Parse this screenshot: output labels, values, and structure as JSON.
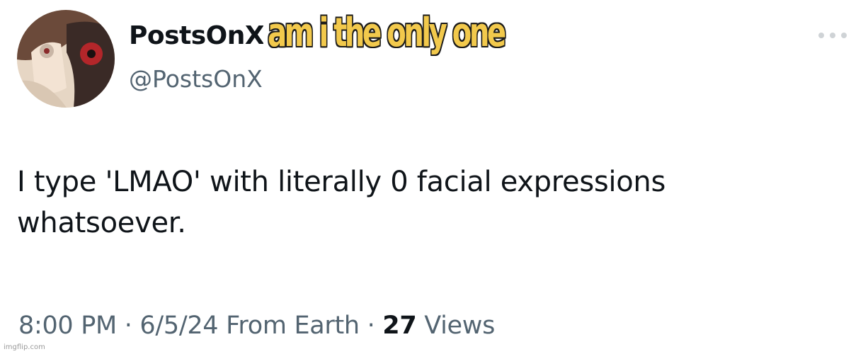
{
  "tweet": {
    "display_name": "PostsOnX",
    "handle": "@PostsOnX",
    "text": "I type 'LMAO' with literally 0 facial expressions whatsoever.",
    "time": "8:00 PM",
    "date": "6/5/24",
    "source": "From Earth",
    "separator": "·",
    "views_count": "27",
    "views_label": "Views"
  },
  "caption": "am i the only one",
  "watermark": "imgflip.com",
  "icons": {
    "avatar": "profile-picture",
    "more": "more-options-icon"
  },
  "colors": {
    "caption_fill": "#f2c94c",
    "caption_outline": "#1a1a1a",
    "secondary_text": "#536471",
    "primary_text": "#0f1419"
  }
}
